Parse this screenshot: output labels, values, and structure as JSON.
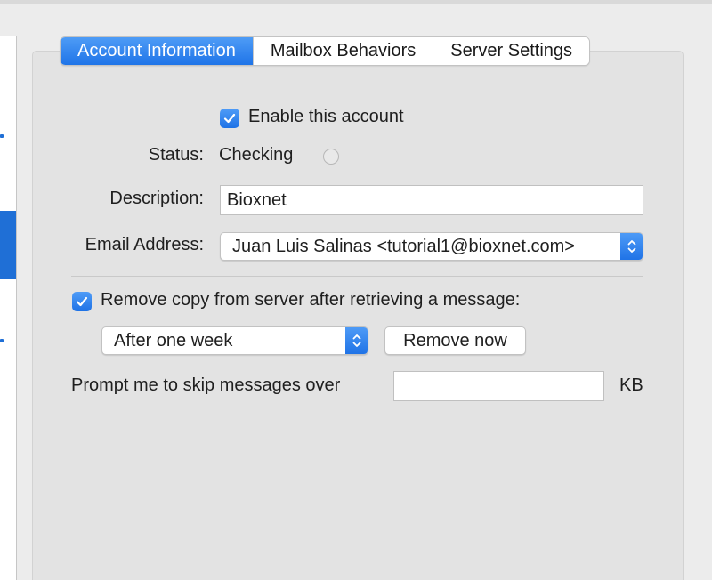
{
  "tabs": [
    {
      "label": "Account Information",
      "active": true
    },
    {
      "label": "Mailbox Behaviors",
      "active": false
    },
    {
      "label": "Server Settings",
      "active": false
    }
  ],
  "enable_account": {
    "label": "Enable this account",
    "checked": true
  },
  "status": {
    "label": "Status:",
    "value": "Checking"
  },
  "description": {
    "label": "Description:",
    "value": "Bioxnet"
  },
  "email_address": {
    "label": "Email Address:",
    "value": "Juan Luis Salinas <tutorial1@bioxnet.com>"
  },
  "remove_copy": {
    "label": "Remove copy from server after retrieving a message:",
    "checked": true
  },
  "remove_interval": {
    "selected": "After one week"
  },
  "remove_now_button": {
    "label": "Remove now"
  },
  "prompt_skip": {
    "label": "Prompt me to skip messages over",
    "value": "",
    "unit": "KB"
  },
  "colors": {
    "accent": "#1f74e8",
    "panel": "#e3e3e3",
    "window": "#ececec"
  },
  "icons": {
    "checkbox": "checkmark-icon",
    "popup": "updown-chevron-icon",
    "status": "progress-indicator-icon"
  }
}
